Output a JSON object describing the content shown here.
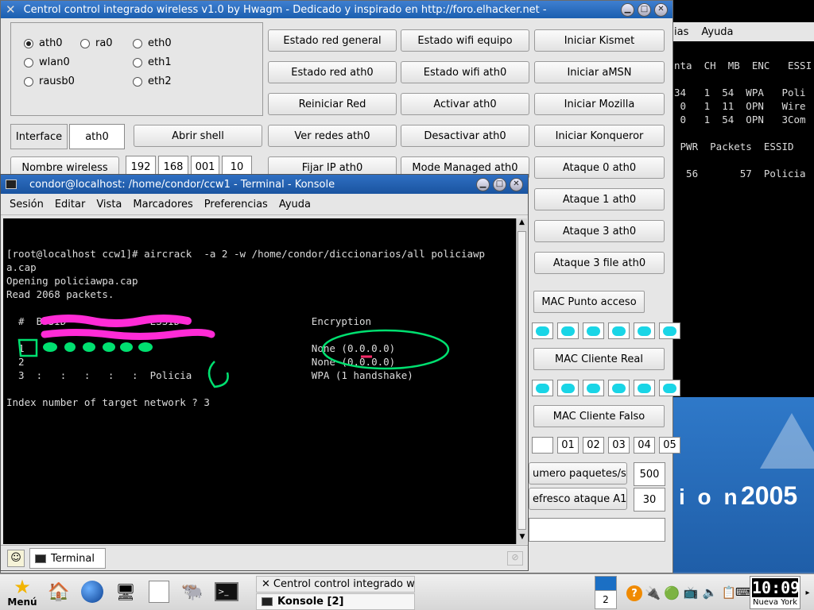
{
  "main_window": {
    "title": "Centrol control integrado wireless v1.0 by Hwagm - Dedicado y inspirado en http://foro.elhacker.net -",
    "radios": [
      {
        "label": "ath0",
        "checked": true
      },
      {
        "label": "ra0",
        "checked": false
      },
      {
        "label": "eth0",
        "checked": false
      },
      {
        "label": "wlan0",
        "checked": false
      },
      {
        "label": "eth1",
        "checked": false
      },
      {
        "label": "rausb0",
        "checked": false
      },
      {
        "label": "eth2",
        "checked": false
      }
    ],
    "interface_label": "Interface",
    "interface_value": "ath0",
    "abrir_shell": "Abrir shell",
    "nombre_wireless": "Nombre wireless",
    "ip_fields": [
      "192",
      "168",
      "001",
      "10"
    ],
    "buttons_col1": [
      "Estado red general",
      "Estado red ath0",
      "Reiniciar Red",
      "Ver redes ath0",
      "Fijar IP ath0"
    ],
    "buttons_col2": [
      "Estado wifi equipo",
      "Estado wifi ath0",
      "Activar ath0",
      "Desactivar ath0",
      "Mode Managed ath0"
    ],
    "buttons_col3": [
      "Iniciar Kismet",
      "Iniciar aMSN",
      "Iniciar Mozilla",
      "Iniciar Konqueror",
      "Ataque 0 ath0",
      "Ataque 1 ath0",
      "Ataque 3 ath0",
      "Ataque 3 file ath0"
    ],
    "mac_punto_acceso": "MAC Punto acceso",
    "mac_cliente_real": "MAC Cliente Real",
    "mac_cliente_falso": "MAC Cliente Falso",
    "mac_falso_fields": [
      "01",
      "02",
      "03",
      "04",
      "05"
    ],
    "numero_paquetes_label": "umero paquetes/s",
    "numero_paquetes_value": "500",
    "refresco_label": "efresco ataque A1",
    "refresco_value": "30"
  },
  "bg_terminal": {
    "menu": [
      "ias",
      "Ayuda"
    ],
    "lines": [
      "nta  CH  MB  ENC   ESSI",
      "",
      "34   1  54  WPA   Poli",
      " 0   1  11  OPN   Wire",
      " 0   1  54  OPN   3Com",
      "",
      " PWR  Packets  ESSID",
      "",
      "  56       57  Policia"
    ]
  },
  "wallpaper": {
    "text_a": "i o n",
    "text_b": "2005"
  },
  "konsole": {
    "title": "condor@localhost: /home/condor/ccw1 - Terminal - Konsole",
    "menu": [
      "Sesión",
      "Editar",
      "Vista",
      "Marcadores",
      "Preferencias",
      "Ayuda"
    ],
    "lines": [
      "[root@localhost ccw1]# aircrack  -a 2 -w /home/condor/diccionarios/all policiawp",
      "a.cap",
      "Opening policiawpa.cap",
      "Read 2068 packets.",
      "",
      "  #  BSSID              ESSID                      Encryption",
      "",
      "  1                                                None (0.0.0.0)",
      "  2                                                None (0.0.0.0)",
      "  3  :   :   :   :   :  Policia                    WPA (1 handshake)",
      "",
      "Index number of target network ? 3"
    ],
    "tab_label": "Terminal"
  },
  "taskbar": {
    "menu_label": "Menú",
    "tasks": [
      "Centrol control integrado w",
      "Konsole [2]"
    ],
    "desktop_number": "2",
    "clock": "10:09",
    "city": "Nueva York"
  },
  "colors": {
    "accent": "#1b6fc4",
    "annotation": "#00e070",
    "mac_blob": "#19d5e6",
    "scribble": "#ff2bd6"
  }
}
